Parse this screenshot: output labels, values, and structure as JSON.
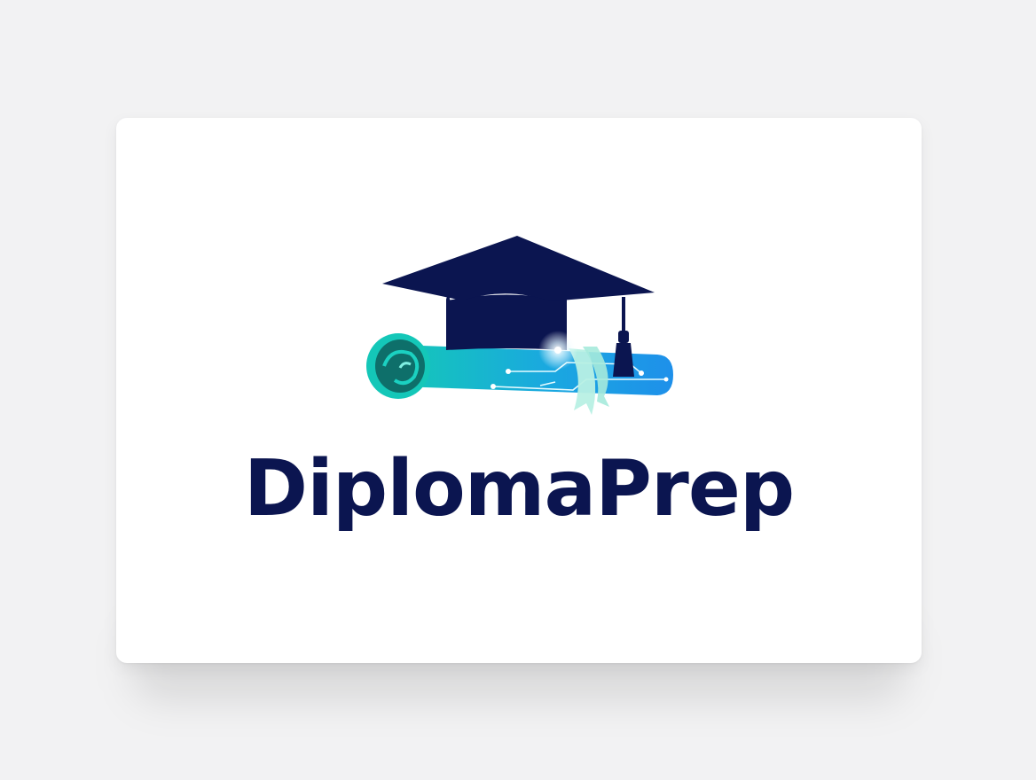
{
  "brand": {
    "name": "DiplomaPrep"
  },
  "colors": {
    "background": "#f2f2f3",
    "card": "#ffffff",
    "navy": "#0b1550",
    "teal": "#14c7b8",
    "blue": "#1e90ea",
    "ribbon": "#b8f0e4"
  },
  "icons": {
    "mark": "graduation-cap-diploma-scroll-icon"
  }
}
